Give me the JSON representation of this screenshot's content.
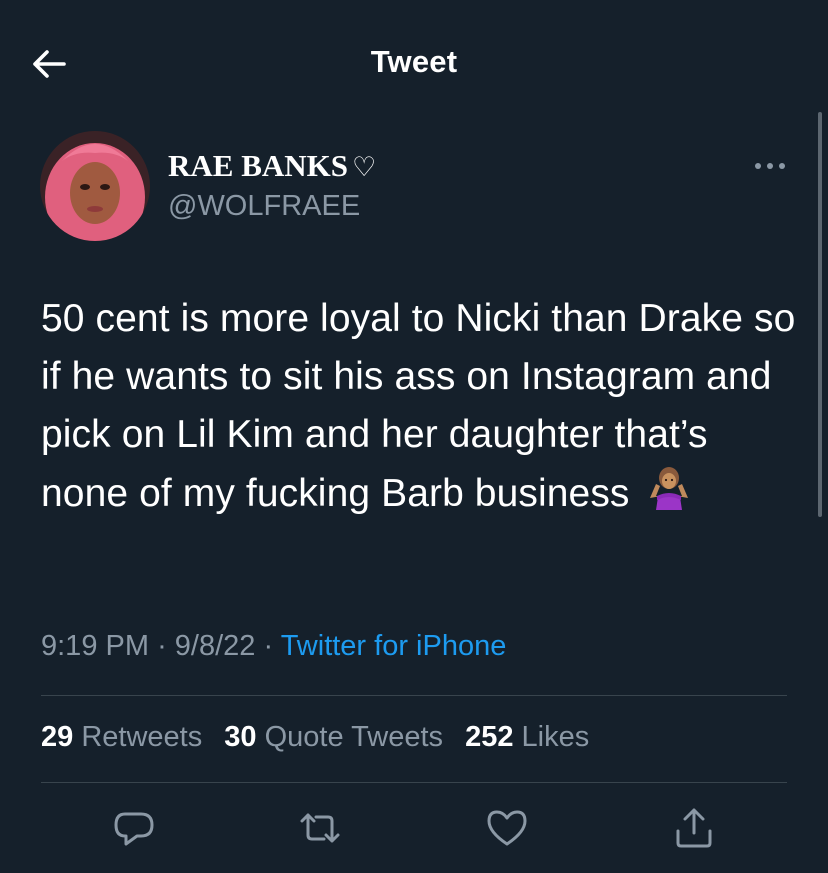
{
  "header": {
    "title": "Tweet"
  },
  "tweet": {
    "author_name": "RAE BANKS",
    "author_name_glyph": "♡",
    "handle": "@WOLFRAEE",
    "text": "50 cent is more loyal to Nicki than Drake so if he wants to sit his ass on Instagram and pick on Lil Kim and her daughter that’s none of my fucking Barb business",
    "time": "9:19 PM",
    "date": "9/8/22",
    "source": "Twitter for iPhone"
  },
  "stats": {
    "retweets_count": "29",
    "retweets_label": "Retweets",
    "quotes_count": "30",
    "quotes_label": "Quote Tweets",
    "likes_count": "252",
    "likes_label": "Likes"
  },
  "icons": [
    "back-arrow-icon",
    "more-icon",
    "shrug-emoji-icon",
    "reply-icon",
    "retweet-icon",
    "like-icon",
    "share-icon"
  ],
  "colors": {
    "background": "#15202b",
    "text": "#ffffff",
    "secondary": "#8b98a5",
    "accent": "#1d9bf0",
    "divider": "#38444d"
  }
}
